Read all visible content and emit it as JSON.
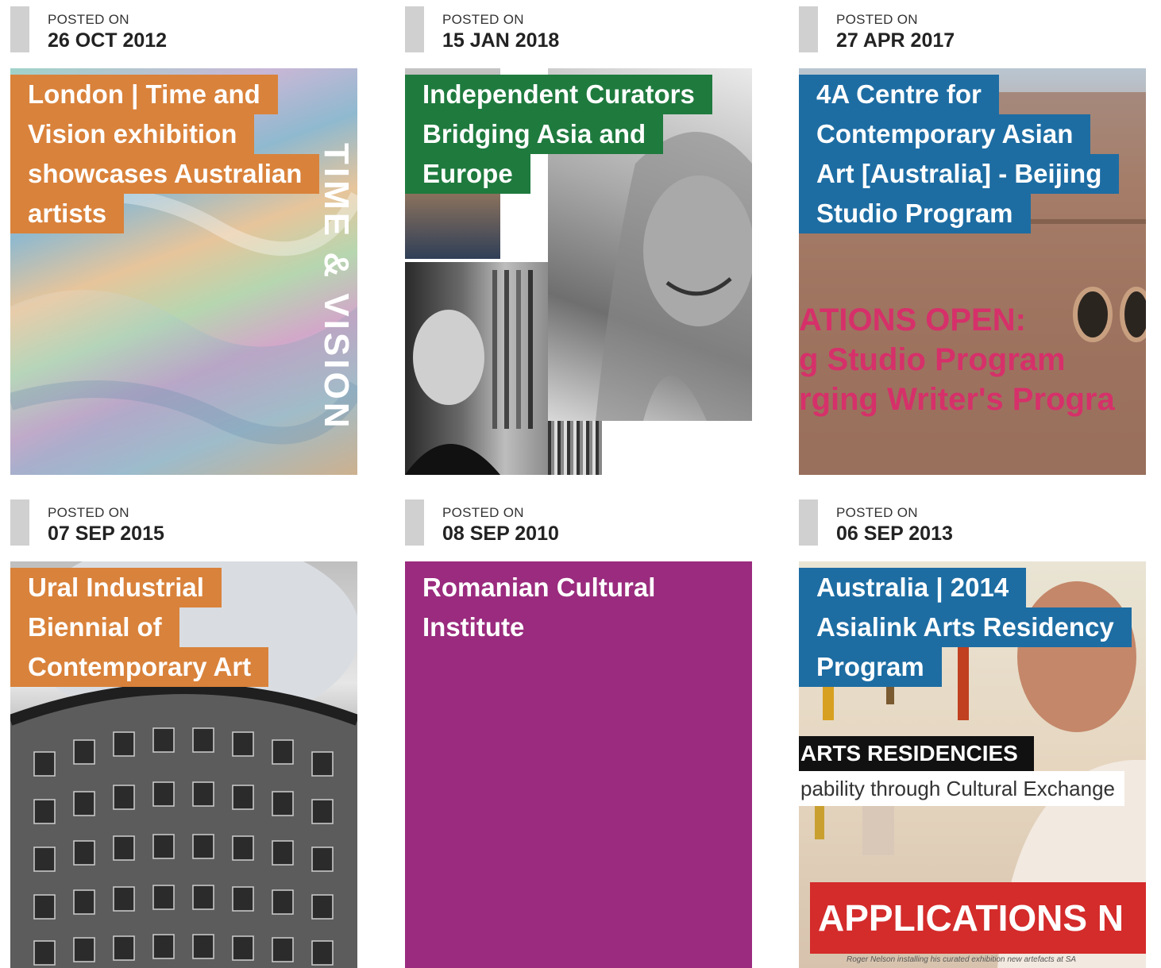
{
  "posts": [
    {
      "posted_label": "POSTED ON",
      "date": "26 OCT 2012",
      "title_lines": [
        "London | Time and",
        "Vision exhibition",
        "showcases Australian",
        "artists"
      ],
      "color": "#d9823b",
      "image_text": "TIME & VISION"
    },
    {
      "posted_label": "POSTED ON",
      "date": "15 JAN 2018",
      "title_lines": [
        "Independent Curators",
        "Bridging Asia and",
        "Europe"
      ],
      "color": "#1f7a3e"
    },
    {
      "posted_label": "POSTED ON",
      "date": "27 APR 2017",
      "title_lines": [
        "4A Centre for",
        "Contemporary Asian",
        "Art [Australia] - Beijing",
        "Studio Program"
      ],
      "color": "#1d6da3",
      "image_text": [
        "ATIONS OPEN:",
        "g Studio Program",
        "rging Writer's Progra"
      ]
    },
    {
      "posted_label": "POSTED ON",
      "date": "07 SEP 2015",
      "title_lines": [
        "Ural Industrial",
        "Biennial of",
        "Contemporary Art"
      ],
      "color": "#d9823b"
    },
    {
      "posted_label": "POSTED ON",
      "date": "08 SEP 2010",
      "title_lines": [
        "Romanian Cultural",
        "Institute"
      ],
      "color": "#9a2b7e"
    },
    {
      "posted_label": "POSTED ON",
      "date": "06 SEP 2013",
      "title_lines": [
        "Australia | 2014",
        "Asialink Arts Residency",
        "Program"
      ],
      "color": "#1d6da3",
      "image_text": [
        "ARTS RESIDENCIES",
        "pability through Cultural Exchange",
        "APPLICATIONS N",
        "Roger Nelson installing his curated exhibition new artefacts at SA"
      ]
    }
  ]
}
